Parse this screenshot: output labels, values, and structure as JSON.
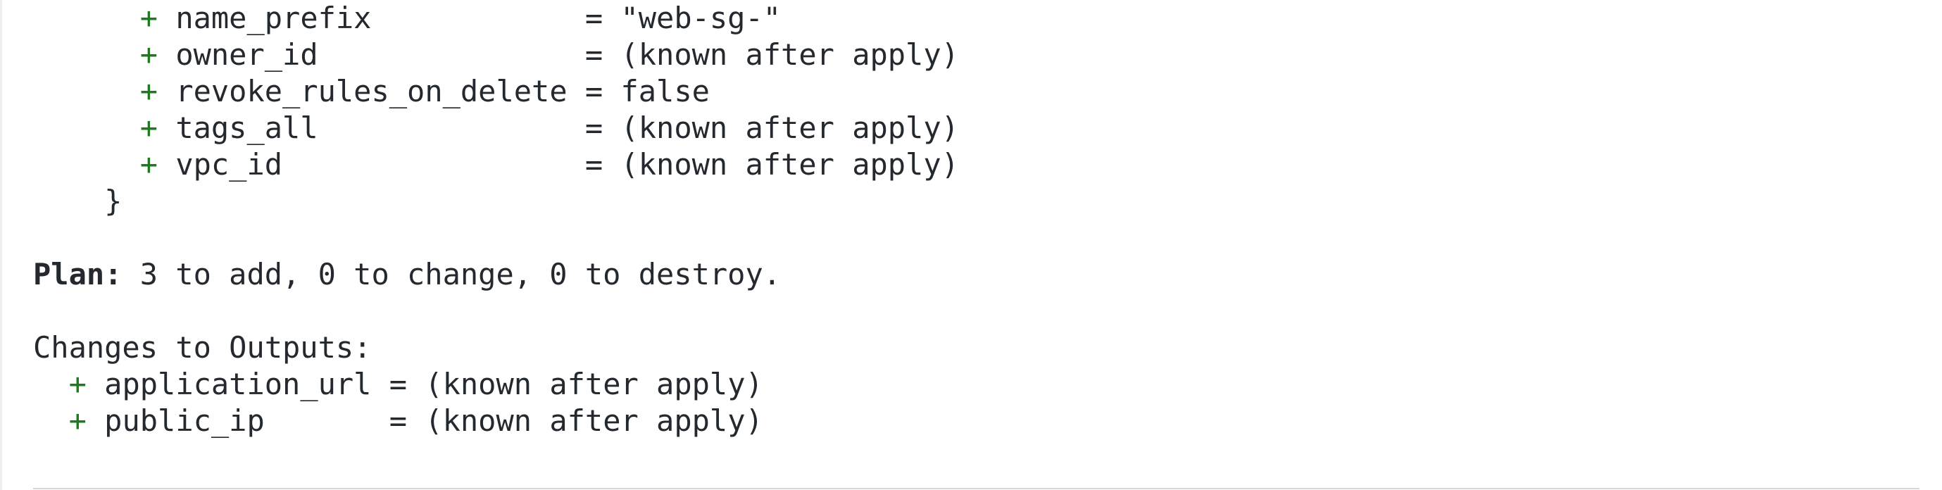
{
  "resource_attributes": [
    {
      "marker": "+",
      "key": "name_prefix           ",
      "sep": " = ",
      "value": "\"web-sg-\""
    },
    {
      "marker": "+",
      "key": "owner_id              ",
      "sep": " = ",
      "value": "(known after apply)"
    },
    {
      "marker": "+",
      "key": "revoke_rules_on_delete",
      "sep": " = ",
      "value": "false"
    },
    {
      "marker": "+",
      "key": "tags_all              ",
      "sep": " = ",
      "value": "(known after apply)"
    },
    {
      "marker": "+",
      "key": "vpc_id                ",
      "sep": " = ",
      "value": "(known after apply)"
    }
  ],
  "closing_brace": "}",
  "plan": {
    "label": "Plan:",
    "summary": " 3 to add, 0 to change, 0 to destroy."
  },
  "outputs": {
    "heading": "Changes to Outputs:",
    "items": [
      {
        "marker": "+",
        "key": "application_url",
        "sep": " = ",
        "value": "(known after apply)"
      },
      {
        "marker": "+",
        "key": "public_ip      ",
        "sep": " = ",
        "value": "(known after apply)"
      }
    ]
  },
  "colors": {
    "add_marker": "#1f7a1f",
    "text": "#24292f",
    "background": "#ffffff"
  }
}
